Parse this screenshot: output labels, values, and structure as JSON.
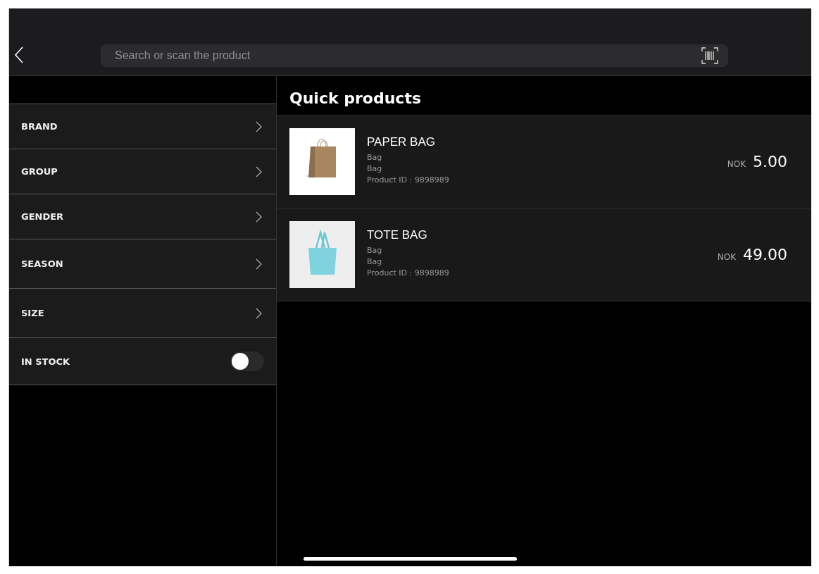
{
  "search": {
    "placeholder": "Search or scan the product"
  },
  "filters": [
    {
      "kind": "nav",
      "label": "BRAND"
    },
    {
      "kind": "nav",
      "label": "GROUP"
    },
    {
      "kind": "nav",
      "label": "GENDER"
    },
    {
      "kind": "nav",
      "label": "SEASON"
    },
    {
      "kind": "nav",
      "label": "SIZE"
    },
    {
      "kind": "toggle",
      "label": "IN STOCK",
      "on": false
    }
  ],
  "section_title": "Quick products",
  "products": [
    {
      "kind": "paper",
      "name": "PAPER BAG",
      "category": "Bag",
      "group": "Bag",
      "product_id": "Product ID : 9898989",
      "currency": "NOK",
      "price": "5.00"
    },
    {
      "kind": "tote",
      "name": "TOTE BAG",
      "category": "Bag",
      "group": "Bag",
      "product_id": "Product ID : 9898989",
      "currency": "NOK",
      "price": "49.00"
    }
  ]
}
